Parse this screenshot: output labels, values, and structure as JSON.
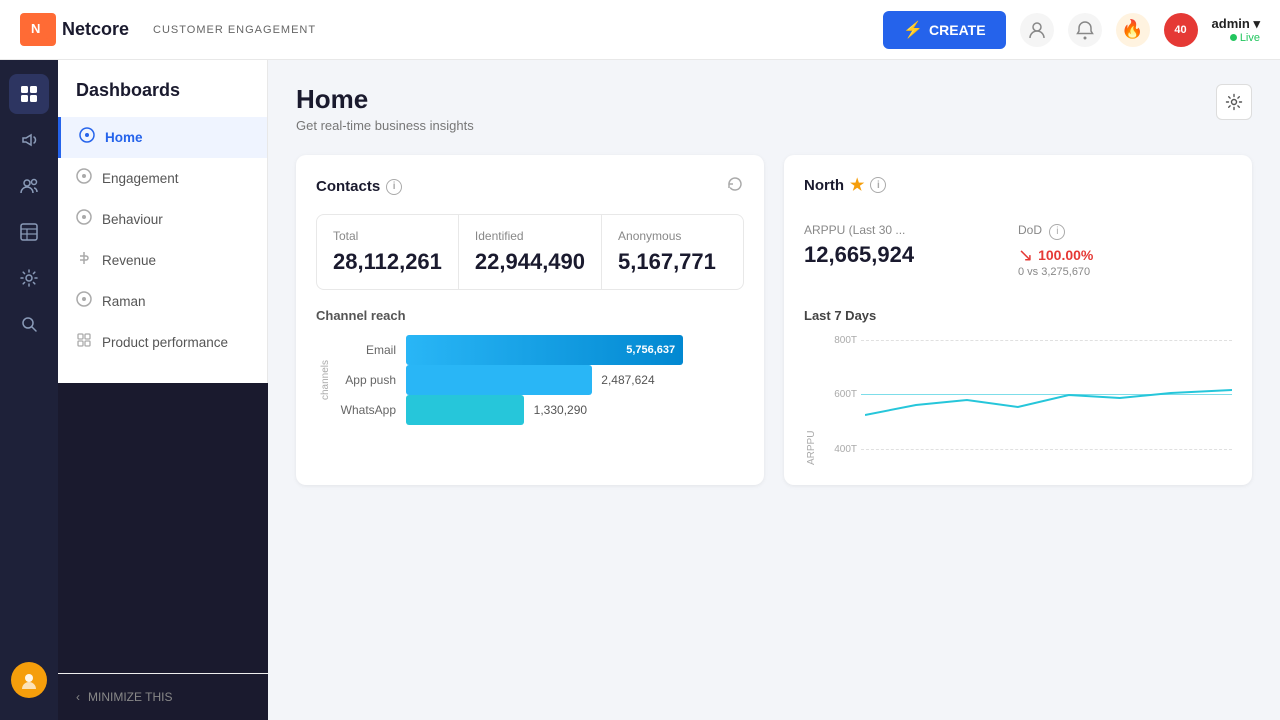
{
  "navbar": {
    "logo_icon": "N",
    "logo_text": "Netcore",
    "subtitle": "CUSTOMER ENGAGEMENT",
    "create_label": "CREATE",
    "admin_name": "admin",
    "admin_dropdown": "▾",
    "admin_status": "Live",
    "notification_count": "40"
  },
  "icon_sidebar": {
    "items": [
      {
        "name": "grid-icon",
        "symbol": "⊞",
        "active": true
      },
      {
        "name": "megaphone-icon",
        "symbol": "📣",
        "active": false
      },
      {
        "name": "people-icon",
        "symbol": "👥",
        "active": false
      },
      {
        "name": "table-icon",
        "symbol": "⊟",
        "active": false
      },
      {
        "name": "gear-icon",
        "symbol": "⚙",
        "active": false
      },
      {
        "name": "search-icon",
        "symbol": "🔍",
        "active": false
      }
    ],
    "avatar_label": "U"
  },
  "sidebar": {
    "title": "Dashboards",
    "items": [
      {
        "label": "Home",
        "icon": "🏠",
        "active": true
      },
      {
        "label": "Engagement",
        "icon": "◎",
        "active": false
      },
      {
        "label": "Behaviour",
        "icon": "◎",
        "active": false
      },
      {
        "label": "Revenue",
        "icon": "◎",
        "active": false
      },
      {
        "label": "Raman",
        "icon": "◎",
        "active": false
      },
      {
        "label": "Product performance",
        "icon": "◎",
        "active": false
      }
    ],
    "minimize_label": "MINIMIZE THIS"
  },
  "page": {
    "title": "Home",
    "subtitle": "Get real-time business insights"
  },
  "contacts_card": {
    "title": "Contacts",
    "stats": [
      {
        "label": "Total",
        "value": "28,112,261"
      },
      {
        "label": "Identified",
        "value": "22,944,490"
      },
      {
        "label": "Anonymous",
        "value": "5,167,771"
      }
    ],
    "channel_reach_label": "Channel reach",
    "channels": [
      {
        "name": "Email",
        "value": "5,756,637",
        "pct": 82
      },
      {
        "name": "App push",
        "value": "2,487,624",
        "pct": 55
      },
      {
        "name": "WhatsApp",
        "value": "1,330,290",
        "pct": 35
      }
    ]
  },
  "north_card": {
    "title": "North",
    "arppu_label": "ARPPU (Last 30 ...",
    "arppu_value": "12,665,924",
    "dod_label": "DoD",
    "dod_value": "100.00%",
    "dod_sub": "0 vs 3,275,670",
    "last7_label": "Last 7 Days",
    "y_labels": [
      "800T",
      "600T",
      "400T"
    ],
    "arppu_axis": "ARPPU",
    "chart_line_color": "#26c6da"
  }
}
